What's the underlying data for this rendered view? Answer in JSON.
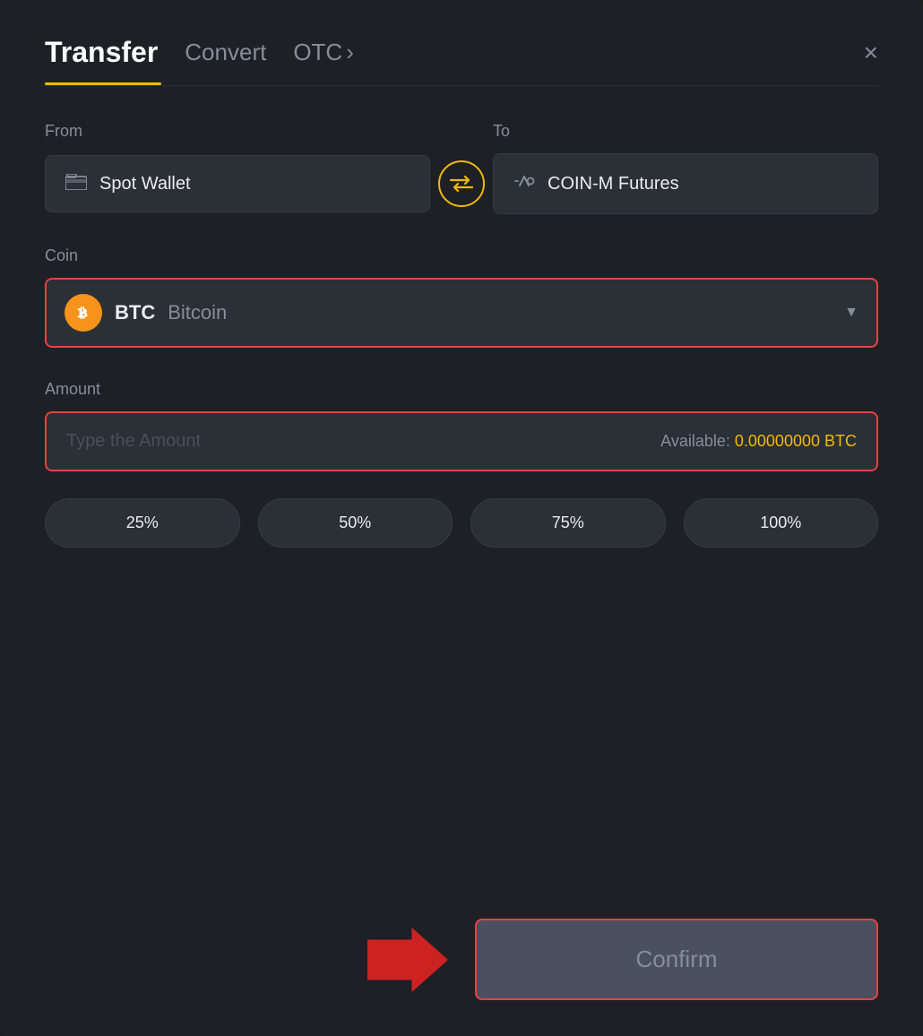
{
  "header": {
    "title": "Transfer",
    "tab_convert": "Convert",
    "tab_otc": "OTC",
    "tab_otc_chevron": "›",
    "close_label": "×"
  },
  "from_section": {
    "label": "From",
    "wallet_name": "Spot Wallet",
    "wallet_icon": "🪪"
  },
  "to_section": {
    "label": "To",
    "wallet_name": "COIN-M Futures",
    "wallet_icon": "↑"
  },
  "swap": {
    "icon": "⇄"
  },
  "coin_section": {
    "label": "Coin",
    "coin_symbol": "BTC",
    "coin_name": "Bitcoin",
    "chevron": "▼"
  },
  "amount_section": {
    "label": "Amount",
    "placeholder": "Type the Amount",
    "available_label": "Available:",
    "available_value": "0.00000000 BTC"
  },
  "percentage_buttons": [
    {
      "label": "25%"
    },
    {
      "label": "50%"
    },
    {
      "label": "75%"
    },
    {
      "label": "100%"
    }
  ],
  "confirm_button": {
    "label": "Confirm"
  }
}
